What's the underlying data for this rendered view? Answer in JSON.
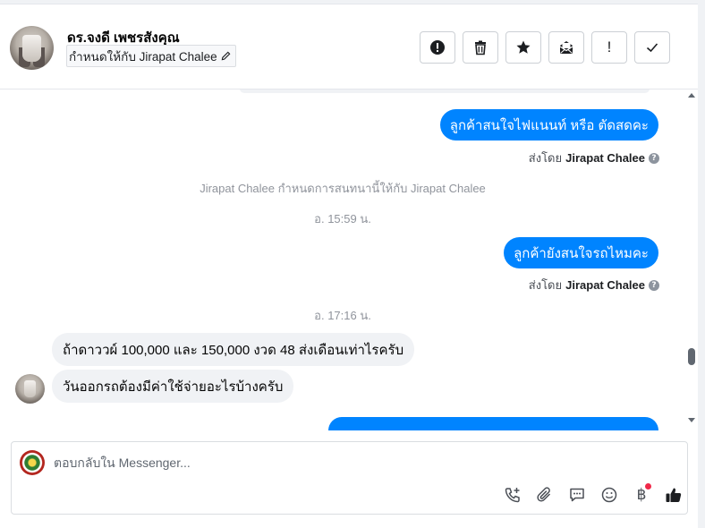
{
  "header": {
    "contact_name": "ดร.จงดี เพชรสังคุณ",
    "assign_label": "กำหนดให้กับ Jirapat Chalee",
    "toolbar": [
      {
        "icon": "report-spam-icon",
        "label": "!"
      },
      {
        "icon": "trash-icon"
      },
      {
        "icon": "star-icon"
      },
      {
        "icon": "mark-unread-icon"
      },
      {
        "icon": "exclamation-icon",
        "label": "!"
      },
      {
        "icon": "checkmark-icon"
      }
    ]
  },
  "messages": {
    "out_1": "ลูกค้าสนใจไฟแนนท์ หรือ ตัดสดคะ",
    "sent_by_prefix": "ส่งโดย",
    "sent_by_name": "Jirapat Chalee",
    "system_assign": "Jirapat Chalee กำหนดการสนทนานี้ให้กับ Jirapat Chalee",
    "time_1": "อ. 15:59 น.",
    "out_2": "ลูกค้ายังสนใจรถไหมคะ",
    "time_2": "อ. 17:16 น.",
    "in_1": "ถ้าดาววผ์ 100,000 และ 150,000 งวด 48 ส่งเดือนเท่าไรครับ",
    "in_2": "วันออกรถต้องมีค่าใช้จ่ายอะไรบ้างครับ"
  },
  "composer": {
    "placeholder": "ตอบกลับใน Messenger...",
    "icons": [
      "call-add-icon",
      "attachment-icon",
      "saved-reply-icon",
      "emoji-icon",
      "baht-payment-icon",
      "thumbs-up-icon"
    ],
    "baht_symbol": "฿"
  },
  "colors": {
    "accent": "#0084ff",
    "incoming_bubble": "#f0f2f5",
    "notification": "#f02849"
  }
}
